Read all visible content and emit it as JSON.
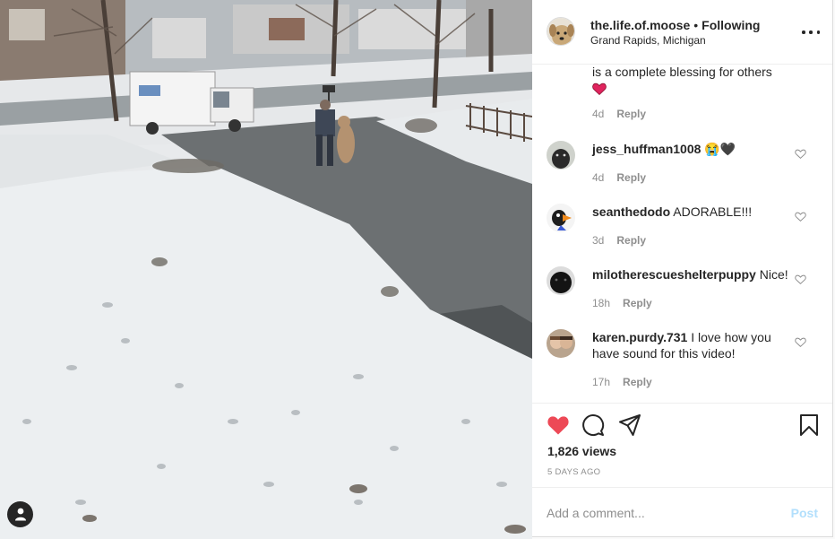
{
  "post": {
    "username": "the.life.of.moose",
    "separator": "•",
    "follow_status": "Following",
    "location": "Grand Rapids, Michigan",
    "avatar_icon": "dog-avatar",
    "more_icon": "more-options-icon"
  },
  "comments": [
    {
      "username": "",
      "text": "is a complete blessing for others",
      "emoji": "red-heart-icon",
      "age": "4d",
      "reply_label": "Reply"
    },
    {
      "username": "jess_huffman1008",
      "text": "😭🖤",
      "age": "4d",
      "reply_label": "Reply"
    },
    {
      "username": "seanthedodo",
      "text": "ADORABLE!!!",
      "age": "3d",
      "reply_label": "Reply"
    },
    {
      "username": "milotherescueshelterpuppy",
      "text": "Nice!",
      "age": "18h",
      "reply_label": "Reply"
    },
    {
      "username": "karen.purdy.731",
      "text": "I love how you have sound for this video!",
      "age": "17h",
      "reply_label": "Reply"
    }
  ],
  "actions": {
    "views": "1,826 views",
    "timestamp": "5 DAYS AGO",
    "like_color": "#ed4956",
    "liked": true
  },
  "composer": {
    "placeholder": "Add a comment...",
    "post_label": "Post",
    "post_color": "#b2dffc"
  },
  "media": {
    "type": "video",
    "tag_icon": "user-tag-icon"
  }
}
